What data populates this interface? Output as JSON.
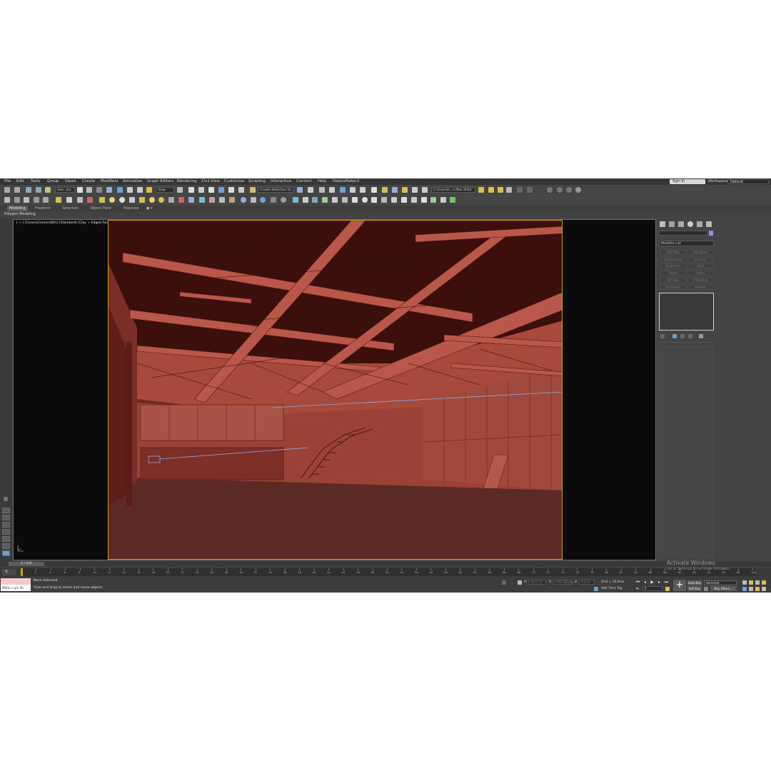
{
  "menu": [
    "File",
    "Edit",
    "Tools",
    "Group",
    "Views",
    "Create",
    "Modifiers",
    "Animation",
    "Graph Editors",
    "Rendering",
    "Civil View",
    "Customize",
    "Scripting",
    "Interactive",
    "Content",
    "Help",
    "DebrisMaker2"
  ],
  "signin_label": "Sign In",
  "workspaces_label": "Workspaces:",
  "workspaces_value": "Default",
  "toolbar": {
    "filter_value": "Geo...try",
    "refcoord_value": "View",
    "selection_set": "Create Selection Se",
    "path_value": "C:\\Users\\h...s Max 2020"
  },
  "ribbon_tabs": [
    "Modeling",
    "Freeform",
    "Selection",
    "Object Paint",
    "Populate"
  ],
  "ribbon_active": "Modeling",
  "subribbon_label": "Polygon Modeling",
  "viewport_label": "[ + ] [CoronaCamera001] [Standard] [Clay + Edged Faces]",
  "command_panel": {
    "modifier_list": "Modifier List",
    "modifier_buttons": [
      "Edit Poly",
      "Edit Spline",
      "TurboSmooth",
      "Extrude",
      "Symmetry",
      "Shell",
      "Sweep",
      "Lathe",
      "FFD Box",
      "FFD 4x4x4",
      "Symmetry",
      "Chamfer"
    ]
  },
  "time_slider": "0 / 100",
  "timeline_ticks": [
    "0",
    "2",
    "4",
    "6",
    "8",
    "10",
    "12",
    "14",
    "16",
    "18",
    "20",
    "22",
    "24",
    "26",
    "28",
    "30",
    "32",
    "34",
    "36",
    "38",
    "40",
    "42",
    "44",
    "46",
    "48",
    "50",
    "52",
    "54",
    "56",
    "58",
    "60",
    "62",
    "64",
    "66",
    "68",
    "70",
    "72",
    "74",
    "76",
    "78",
    "80",
    "82",
    "84",
    "86",
    "88",
    "90",
    "92",
    "94",
    "96",
    "98",
    "100"
  ],
  "maxscript_label": "MAXScript Mi",
  "status": {
    "selection": "None Selected",
    "prompt": "Click and drag to select and move objects",
    "x_label": "X:",
    "x_value": "8522.04",
    "y_label": "Y:",
    "y_value": "4962.866cm",
    "z_label": "Z:",
    "z_value": "0.0cm",
    "grid": "Grid = 10.0cm",
    "add_time_tag": "Add Time Tag",
    "auto_key": "Auto Key",
    "set_key": "Set Key",
    "selected_value": "Selected",
    "key_filters": "Key Filters...",
    "frame_value": "0"
  },
  "activate_windows": {
    "title": "Activate Windows",
    "subtitle": "Go to Settings to activate Windows."
  },
  "colors": {
    "scene_red": "#8a3a32",
    "floor": "#5c2a24",
    "accent_yellow": "#c9a200"
  }
}
